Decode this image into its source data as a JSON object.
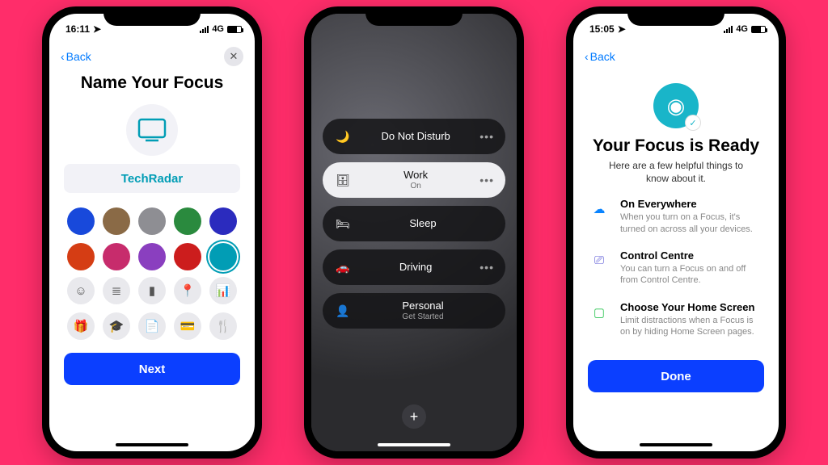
{
  "phone1": {
    "status": {
      "time": "16:11",
      "network": "4G"
    },
    "back_label": "Back",
    "title": "Name Your Focus",
    "name_value": "TechRadar",
    "colors": [
      {
        "hex": "#1849db"
      },
      {
        "hex": "#8a6a46"
      },
      {
        "hex": "#8e8e93"
      },
      {
        "hex": "#2a8a3e"
      },
      {
        "hex": "#2b2bbe"
      },
      {
        "hex": "#d53d14"
      },
      {
        "hex": "#c72c6c"
      },
      {
        "hex": "#8a3fbf"
      },
      {
        "hex": "#cc1d1d"
      },
      {
        "hex": "#019db5",
        "selected": true
      }
    ],
    "icons": [
      "☺",
      "≣",
      "▮",
      "📍",
      "📊",
      "🎁",
      "🎓",
      "📄",
      "💳",
      "🍴"
    ],
    "next_label": "Next"
  },
  "phone2": {
    "items": [
      {
        "icon": "🌙",
        "label": "Do Not Disturb",
        "sub": "",
        "active": false,
        "more": true
      },
      {
        "icon": "🗄",
        "label": "Work",
        "sub": "On",
        "active": true,
        "more": true
      },
      {
        "icon": "🛏",
        "label": "Sleep",
        "sub": "",
        "active": false,
        "more": false
      },
      {
        "icon": "🚗",
        "label": "Driving",
        "sub": "",
        "active": false,
        "more": true
      },
      {
        "icon": "👤",
        "label": "Personal",
        "sub": "Get Started",
        "active": false,
        "more": false
      }
    ],
    "new_label": "New Focus"
  },
  "phone3": {
    "status": {
      "time": "15:05",
      "network": "4G"
    },
    "back_label": "Back",
    "title": "Your Focus is Ready",
    "subtitle": "Here are a few helpful things to know about it.",
    "tips": [
      {
        "icon": "☁",
        "color": "#0a84ff",
        "title": "On Everywhere",
        "body": "When you turn on a Focus, it's turned on across all your devices."
      },
      {
        "icon": "⎚",
        "color": "#5856d6",
        "title": "Control Centre",
        "body": "You can turn a Focus on and off from Control Centre."
      },
      {
        "icon": "▢",
        "color": "#34c759",
        "title": "Choose Your Home Screen",
        "body": "Limit distractions when a Focus is on by hiding Home Screen pages."
      }
    ],
    "done_label": "Done"
  }
}
